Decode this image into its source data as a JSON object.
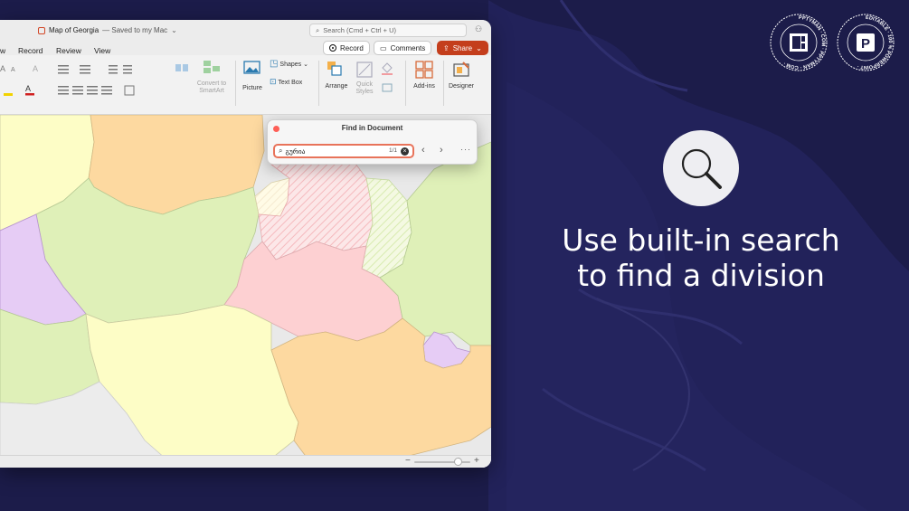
{
  "window": {
    "doc_name": "Map of Georgia",
    "doc_status": "— Saved to my Mac",
    "search_placeholder": "Search (Cmd + Ctrl + U)"
  },
  "menu": {
    "items": [
      "w",
      "Record",
      "Review",
      "View"
    ],
    "record_button": "Record",
    "comments_button": "Comments",
    "share_button": "Share"
  },
  "ribbon": {
    "convert_label": "Convert to SmartArt",
    "picture_label": "Picture",
    "shapes_label": "Shapes",
    "textbox_label": "Text Box",
    "arrange_label": "Arrange",
    "quick_styles_label": "Quick Styles",
    "addins_label": "Add-ins",
    "designer_label": "Designer"
  },
  "find_dialog": {
    "title": "Find in Document",
    "query": "გურია",
    "match_count": "1/1"
  },
  "promo": {
    "headline_line1": "Use built-in search",
    "headline_line2": "to find a division"
  },
  "badges": {
    "left_ring_text": "PPTYMAN · COM · PPTYMAN · COM ·",
    "right_ring_text": "EDITABLE · 100 % POWERPOINT ·",
    "right_letter": "P"
  },
  "colors": {
    "background": "#1c1c4a",
    "share": "#c43e1c",
    "find_border": "#e8735a",
    "region_yellow": "#fdfdc6",
    "region_green": "#dff0b8",
    "region_orange": "#fdd9a0",
    "region_pink": "#fdd0d2",
    "region_purple": "#e6ccf5"
  }
}
